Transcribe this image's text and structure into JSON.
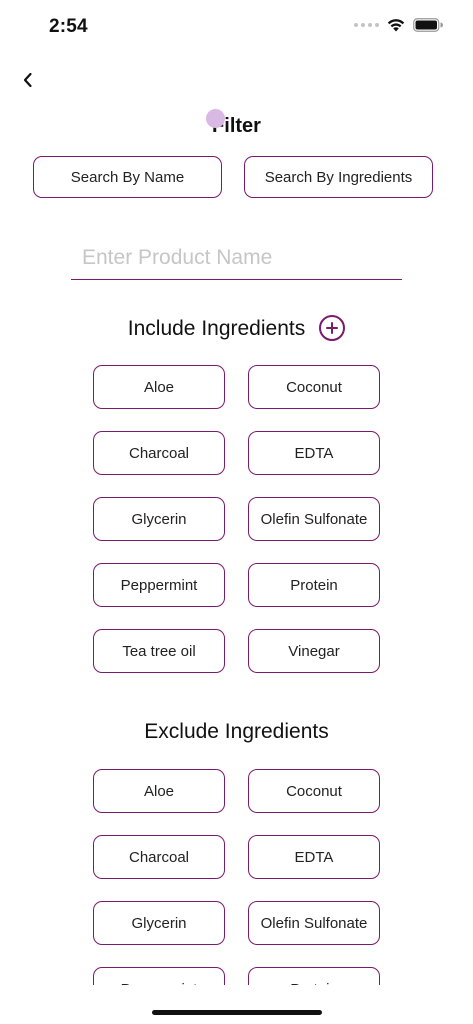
{
  "status_bar": {
    "time": "2:54"
  },
  "header": {
    "title": "Filter"
  },
  "search_modes": {
    "by_name": "Search By Name",
    "by_ingredients": "Search By Ingredients"
  },
  "search": {
    "placeholder": "Enter Product Name",
    "value": ""
  },
  "include": {
    "heading": "Include Ingredients",
    "items": [
      "Aloe",
      "Coconut",
      "Charcoal",
      "EDTA",
      "Glycerin",
      "Olefin Sulfonate",
      "Peppermint",
      "Protein",
      "Tea tree oil",
      "Vinegar"
    ]
  },
  "exclude": {
    "heading": "Exclude Ingredients",
    "items": [
      "Aloe",
      "Coconut",
      "Charcoal",
      "EDTA",
      "Glycerin",
      "Olefin Sulfonate",
      "Peppermint",
      "Protein"
    ]
  },
  "colors": {
    "accent": "#7a1a6c",
    "touch_indicator": "#d9b8e3",
    "placeholder": "#c6c6c6"
  },
  "icons": {
    "back": "chevron-left-icon",
    "add": "plus-circle-icon",
    "wifi": "wifi-icon",
    "battery": "battery-icon"
  }
}
